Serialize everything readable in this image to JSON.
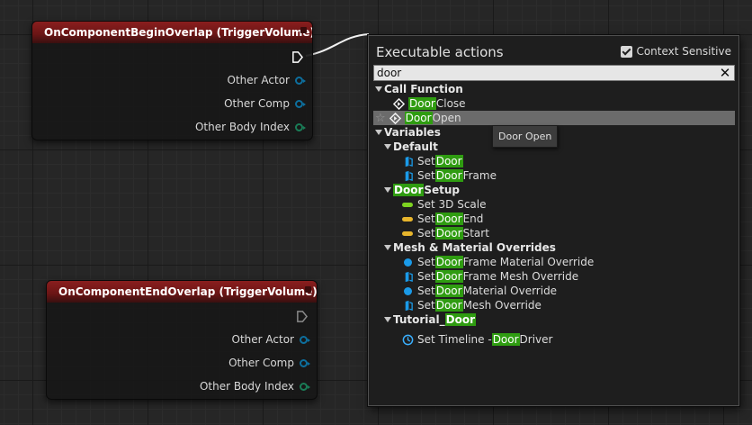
{
  "nodes": {
    "begin_overlap": {
      "title": "OnComponentBeginOverlap (TriggerVolume)",
      "pins": [
        "Other Actor",
        "Other Comp",
        "Other Body Index"
      ]
    },
    "end_overlap": {
      "title": "OnComponentEndOverlap (TriggerVolume)",
      "pins": [
        "Other Actor",
        "Other Comp",
        "Other Body Index"
      ]
    }
  },
  "menu": {
    "title": "Executable actions",
    "context_sensitive_label": "Context Sensitive",
    "context_sensitive_checked": true,
    "search_value": "door",
    "clear_icon": "close-icon",
    "categories": {
      "call_function": "Call Function",
      "variables": "Variables",
      "default": "Default",
      "door_setup_hl": "Door",
      "door_setup_rest": " Setup",
      "mesh_material": "Mesh & Material Overrides",
      "tutorial_pre": "Tutorial_",
      "tutorial_hl": "Door"
    },
    "items": {
      "door_close": {
        "hl": "Door",
        "rest": " Close"
      },
      "door_open": {
        "hl": "Door",
        "rest": " Open"
      },
      "set_door": {
        "pre": "Set ",
        "hl": "Door",
        "rest": ""
      },
      "set_door_frame": {
        "pre": "Set ",
        "hl": "Door",
        "rest": " Frame"
      },
      "set_3d_scale": {
        "pre": "Set 3D Scale"
      },
      "set_door_end": {
        "pre": "Set ",
        "hl": "Door",
        "rest": " End"
      },
      "set_door_start": {
        "pre": "Set ",
        "hl": "Door",
        "rest": " Start"
      },
      "frame_material_override": {
        "pre": "Set ",
        "hl": "Door",
        "rest": " Frame Material Override"
      },
      "frame_mesh_override": {
        "pre": "Set ",
        "hl": "Door",
        "rest": " Frame Mesh Override"
      },
      "material_override": {
        "pre": "Set ",
        "hl": "Door",
        "rest": " Material Override"
      },
      "mesh_override": {
        "pre": "Set ",
        "hl": "Door",
        "rest": " Mesh Override"
      },
      "timeline_driver": {
        "pre": "Set Timeline - ",
        "hl": "Door",
        "rest": " Driver"
      }
    },
    "tooltip": "Door Open",
    "colors": {
      "highlight": "#2f9c11",
      "selected_row": "#6b6b6b",
      "node_header": "#8a1e1e"
    }
  }
}
